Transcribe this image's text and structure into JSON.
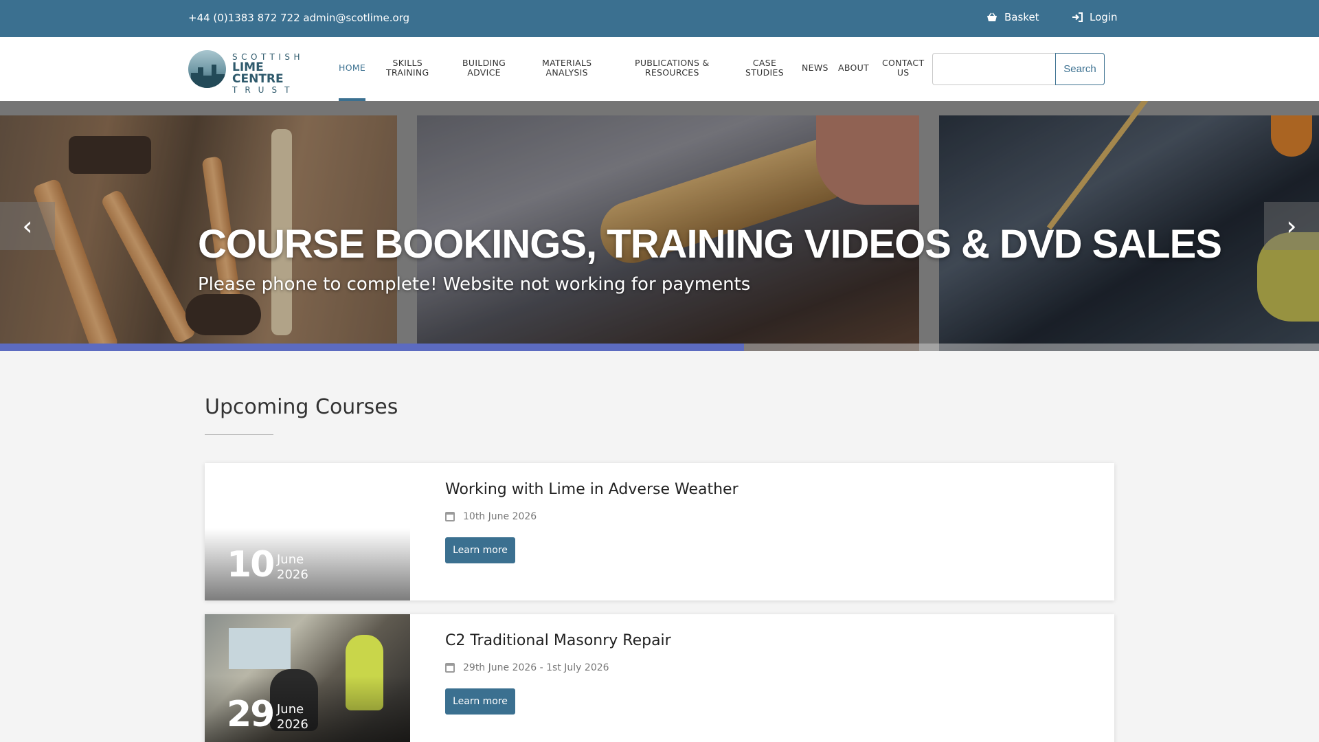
{
  "topbar": {
    "contact": "+44 (0)1383 872 722 admin@scotlime.org",
    "basket_label": "Basket",
    "login_label": "Login"
  },
  "logo": {
    "line1": "SCOTTISH",
    "line2": "LIME CENTRE",
    "line3": "TRUST"
  },
  "nav": {
    "items": [
      {
        "line1": "HOME",
        "line2": ""
      },
      {
        "line1": "SKILLS",
        "line2": "TRAINING"
      },
      {
        "line1": "BUILDING",
        "line2": "ADVICE"
      },
      {
        "line1": "MATERIALS",
        "line2": "ANALYSIS"
      },
      {
        "line1": "PUBLICATIONS &",
        "line2": "RESOURCES"
      },
      {
        "line1": "CASE",
        "line2": "STUDIES"
      },
      {
        "line1": "NEWS",
        "line2": ""
      },
      {
        "line1": "ABOUT",
        "line2": ""
      },
      {
        "line1": "CONTACT",
        "line2": "US"
      }
    ],
    "active_index": 0
  },
  "search": {
    "value": "",
    "button_label": "Search"
  },
  "hero": {
    "title": "COURSE BOOKINGS, TRAINING VIDEOS & DVD SALES",
    "subtitle": "Please phone to complete! Website not working for payments",
    "prev_symbol": "‹",
    "next_symbol": "›",
    "progress_fraction": 0.564
  },
  "upcoming": {
    "title": "Upcoming Courses",
    "courses": [
      {
        "title": "Working with Lime in Adverse Weather",
        "date": "10th June 2026",
        "day": "10",
        "month": "June",
        "year": "2026",
        "button": "Learn more"
      },
      {
        "title": "C2 Traditional Masonry Repair",
        "date": "29th June 2026 - 1st July 2026",
        "day": "29",
        "month": "June",
        "year": "2026",
        "button": "Learn more"
      }
    ]
  },
  "colors": {
    "brand": "#3b7090",
    "progress": "#5c6bc0"
  }
}
